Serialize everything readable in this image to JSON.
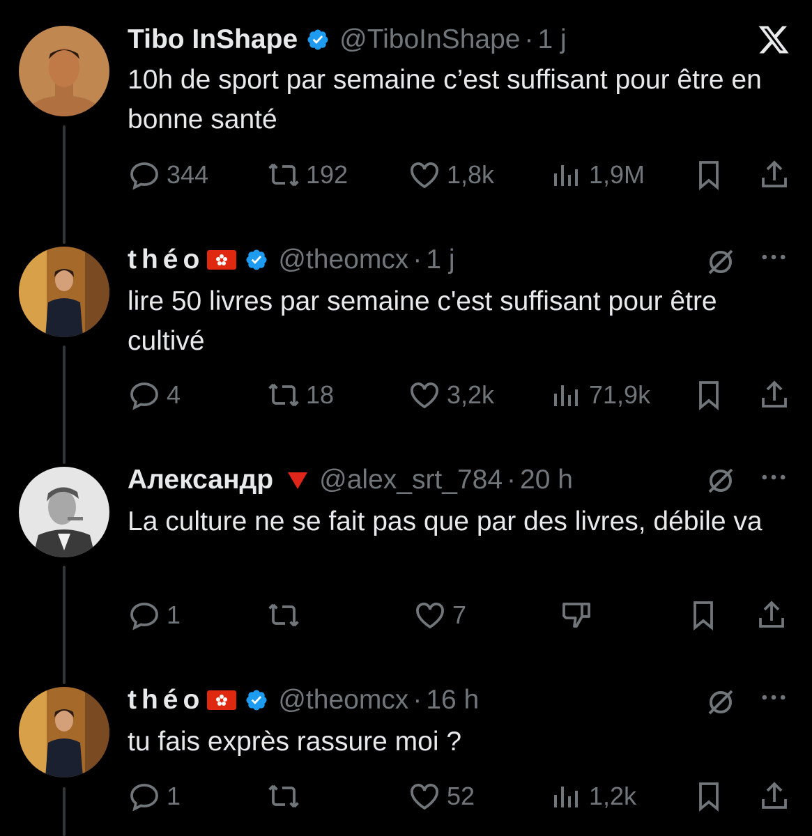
{
  "tweets": [
    {
      "name": "Tibo InShape",
      "handle": "@TiboInShape",
      "sep": "·",
      "time": "1 j",
      "text": "10h de sport par semaine c’est suffisant pour être en bonne santé",
      "replies": "344",
      "retweets": "192",
      "likes": "1,8k",
      "views": "1,9M",
      "top_right_icon": "x-logo-icon"
    },
    {
      "name": "théo",
      "handle": "@theomcx",
      "sep": "·",
      "time": "1 j",
      "text": "lire 50 livres par semaine c'est suffisant pour être cultivé",
      "replies": "4",
      "retweets": "18",
      "likes": "3,2k",
      "views": "71,9k",
      "top_right_icon": "grok-icon"
    },
    {
      "name": "Александр",
      "handle": "@alex_srt_784",
      "sep": "·",
      "time": "20 h",
      "text": "La culture ne se fait pas que par des livres, débile va",
      "replies": "1",
      "retweets": "",
      "likes": "7",
      "top_right_icon": "grok-icon"
    },
    {
      "name": "théo",
      "handle": "@theomcx",
      "sep": "·",
      "time": "16 h",
      "text": "tu fais exprès rassure moi ?",
      "replies": "1",
      "retweets": "",
      "likes": "52",
      "views": "1,2k",
      "top_right_icon": "grok-icon"
    }
  ],
  "colors": {
    "background": "#000000",
    "text": "#e7e9ea",
    "muted": "#71767b",
    "verified": "#1d9bf0",
    "thread_line": "#333639"
  }
}
